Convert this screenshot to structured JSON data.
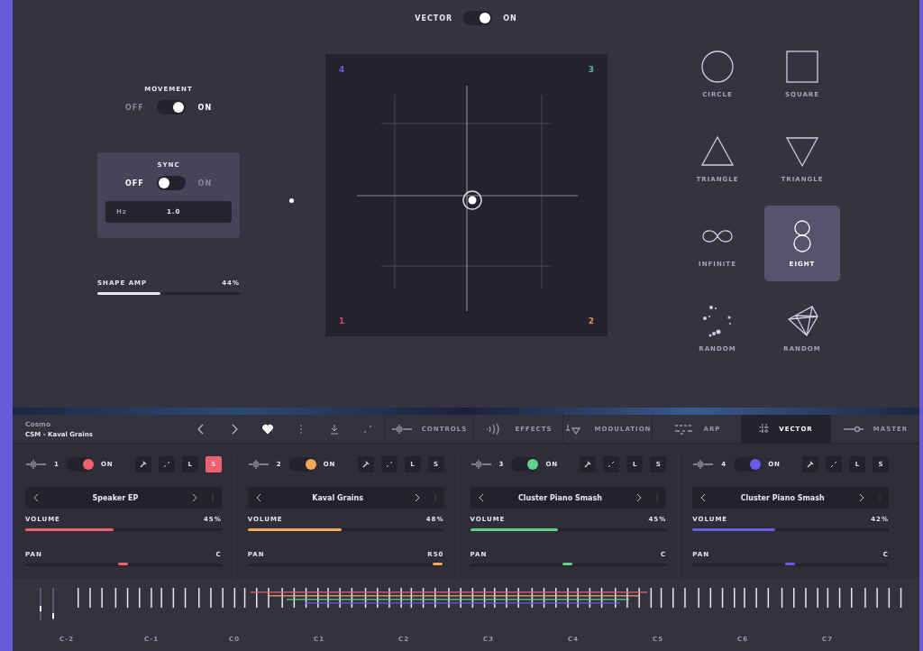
{
  "vector_switch": {
    "label": "VECTOR",
    "state": "ON",
    "on": true
  },
  "movement": {
    "label": "MOVEMENT",
    "off_label": "OFF",
    "on_label": "ON",
    "on": true
  },
  "sync": {
    "label": "SYNC",
    "off_label": "OFF",
    "on_label": "ON",
    "on": false,
    "unit": "Hz",
    "value": "1.0"
  },
  "shape_amp": {
    "label": "SHAPE AMP",
    "reading": "44%",
    "level": 0.44
  },
  "pad": {
    "corners": [
      {
        "label": "4",
        "color": "#6a62c8"
      },
      {
        "label": "3",
        "color": "#5fb8a0"
      },
      {
        "label": "1",
        "color": "#c0506a"
      },
      {
        "label": "2",
        "color": "#d09a60"
      }
    ]
  },
  "shapes": [
    {
      "kind": "circle",
      "label": "CIRCLE",
      "selected": false
    },
    {
      "kind": "square",
      "label": "SQUARE",
      "selected": false
    },
    {
      "kind": "triangle",
      "label": "TRIANGLE",
      "selected": false
    },
    {
      "kind": "triangle_down",
      "label": "TRIANGLE",
      "selected": false
    },
    {
      "kind": "infinite",
      "label": "INFINITE",
      "selected": false
    },
    {
      "kind": "eight",
      "label": "EIGHT",
      "selected": true
    },
    {
      "kind": "dots",
      "label": "RANDOM",
      "selected": false
    },
    {
      "kind": "crystal",
      "label": "RANDOM",
      "selected": false
    }
  ],
  "preset": {
    "bank": "Cosmo",
    "name": "CSM - Kaval Grains",
    "favorite": true
  },
  "tabs": [
    {
      "kind": "controls",
      "label": "CONTROLS",
      "selected": false
    },
    {
      "kind": "effects",
      "label": "EFFECTS",
      "selected": false
    },
    {
      "kind": "modulation",
      "label": "MODULATION",
      "selected": false
    },
    {
      "kind": "arp",
      "label": "ARP",
      "selected": false
    },
    {
      "kind": "vector",
      "label": "VECTOR",
      "selected": true
    },
    {
      "kind": "master",
      "label": "MASTER",
      "selected": false
    }
  ],
  "layers": [
    {
      "number": "1",
      "on": true,
      "state": "ON",
      "color": "#f0606e",
      "latch": {
        "label": "L",
        "on": false
      },
      "solo": {
        "label": "S",
        "on": true
      },
      "sound": "Speaker EP",
      "volume": {
        "label": "VOLUME",
        "reading": "45%",
        "level": 0.45
      },
      "pan": {
        "label": "PAN",
        "reading": "C",
        "level": 0.5
      }
    },
    {
      "number": "2",
      "on": true,
      "state": "ON",
      "color": "#f2a85a",
      "latch": {
        "label": "L",
        "on": false
      },
      "solo": {
        "label": "S",
        "on": false
      },
      "sound": "Kaval Grains",
      "volume": {
        "label": "VOLUME",
        "reading": "48%",
        "level": 0.48
      },
      "pan": {
        "label": "PAN",
        "reading": "R50",
        "level": 0.97
      }
    },
    {
      "number": "3",
      "on": true,
      "state": "ON",
      "color": "#5fd08e",
      "latch": {
        "label": "L",
        "on": false
      },
      "solo": {
        "label": "S",
        "on": false
      },
      "sound": "Cluster Piano Smash",
      "volume": {
        "label": "VOLUME",
        "reading": "45%",
        "level": 0.45
      },
      "pan": {
        "label": "PAN",
        "reading": "C",
        "level": 0.5
      }
    },
    {
      "number": "4",
      "on": true,
      "state": "ON",
      "color": "#6a5cf0",
      "latch": {
        "label": "L",
        "on": false
      },
      "solo": {
        "label": "S",
        "on": false
      },
      "sound": "Cluster Piano Smash",
      "volume": {
        "label": "VOLUME",
        "reading": "42%",
        "level": 0.42
      },
      "pan": {
        "label": "PAN",
        "reading": "C",
        "level": 0.5
      }
    }
  ],
  "keyboard": {
    "octaves": [
      "C-2",
      "C-1",
      "C0",
      "C1",
      "C2",
      "C3",
      "C4",
      "C5",
      "C6",
      "C7"
    ]
  }
}
